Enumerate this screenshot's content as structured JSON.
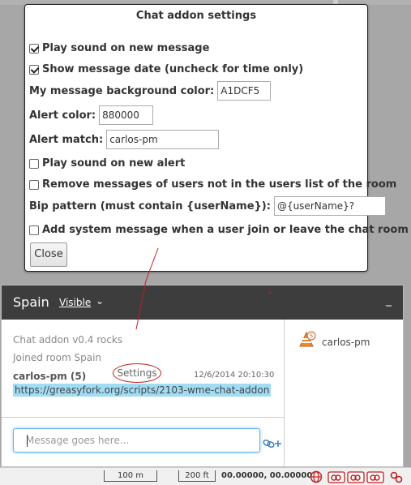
{
  "settings": {
    "title": "Chat addon settings",
    "play_sound_new_message": {
      "label": "Play sound on new message",
      "checked": true
    },
    "show_message_date": {
      "label": "Show message date (uncheck for time only)",
      "checked": true
    },
    "bg_color": {
      "label": "My message background color:",
      "value": "A1DCF5"
    },
    "alert_color": {
      "label": "Alert color:",
      "value": "880000"
    },
    "alert_match": {
      "label": "Alert match:",
      "value": "carlos-pm"
    },
    "play_sound_new_alert": {
      "label": "Play sound on new alert",
      "checked": false
    },
    "remove_messages": {
      "label": "Remove messages of users not in the users list of the room",
      "checked": false
    },
    "bip_pattern": {
      "label": "Bip pattern (must contain {userName}):",
      "value": "@{userName}?"
    },
    "system_message": {
      "label": "Add system message when a user join or leave the chat room",
      "checked": false
    },
    "close_label": "Close"
  },
  "chat": {
    "room": "Spain",
    "visibility": "Visible",
    "minimize": "_",
    "system_line_prefix": "Chat addon v0.4 rocks",
    "settings_link": "Settings",
    "joined_line": "Joined room Spain",
    "message": {
      "author": "carlos-pm (5)",
      "date": "12/6/2014 20:10:30",
      "text": "https://greasyfork.org/scripts/2103-wme-chat-addon"
    },
    "input_placeholder": "Message goes here...",
    "users": [
      {
        "name": "carlos-pm",
        "level": "5"
      }
    ]
  },
  "status_bar": {
    "scale_m": "100 m",
    "scale_ft": "200 ft",
    "coords": "00.00000, 00.00000"
  },
  "colors": {
    "message_bg": "#a1dcf5",
    "header_bg": "#3d3d3d",
    "annotation": "#c02020"
  }
}
